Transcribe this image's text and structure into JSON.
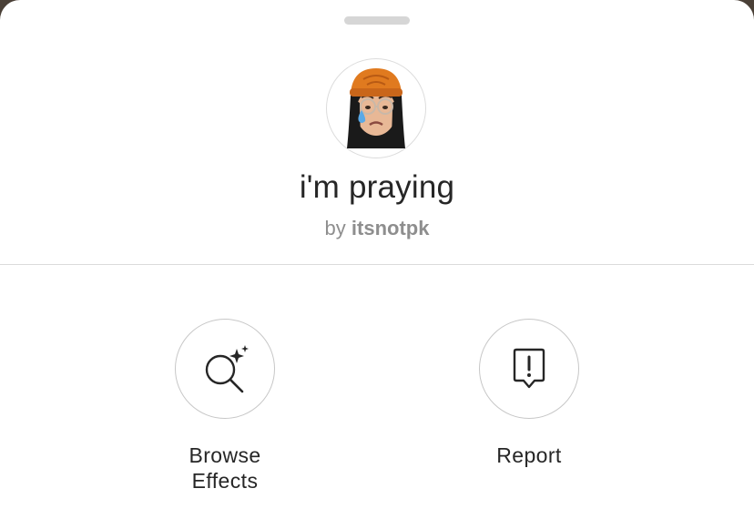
{
  "effect": {
    "title": "i'm praying",
    "by_prefix": "by",
    "author": "itsnotpk"
  },
  "actions": [
    {
      "label_lines": [
        "Browse",
        "Effects"
      ],
      "icon": "search-sparkle-icon"
    },
    {
      "label_lines": [
        "Report"
      ],
      "icon": "report-bubble-icon"
    }
  ],
  "colors": {
    "text": "#262626",
    "secondary": "#8e8e8e",
    "hat": "#e07a1f",
    "hair": "#1a1a1a",
    "tear": "#5aa9e6"
  }
}
